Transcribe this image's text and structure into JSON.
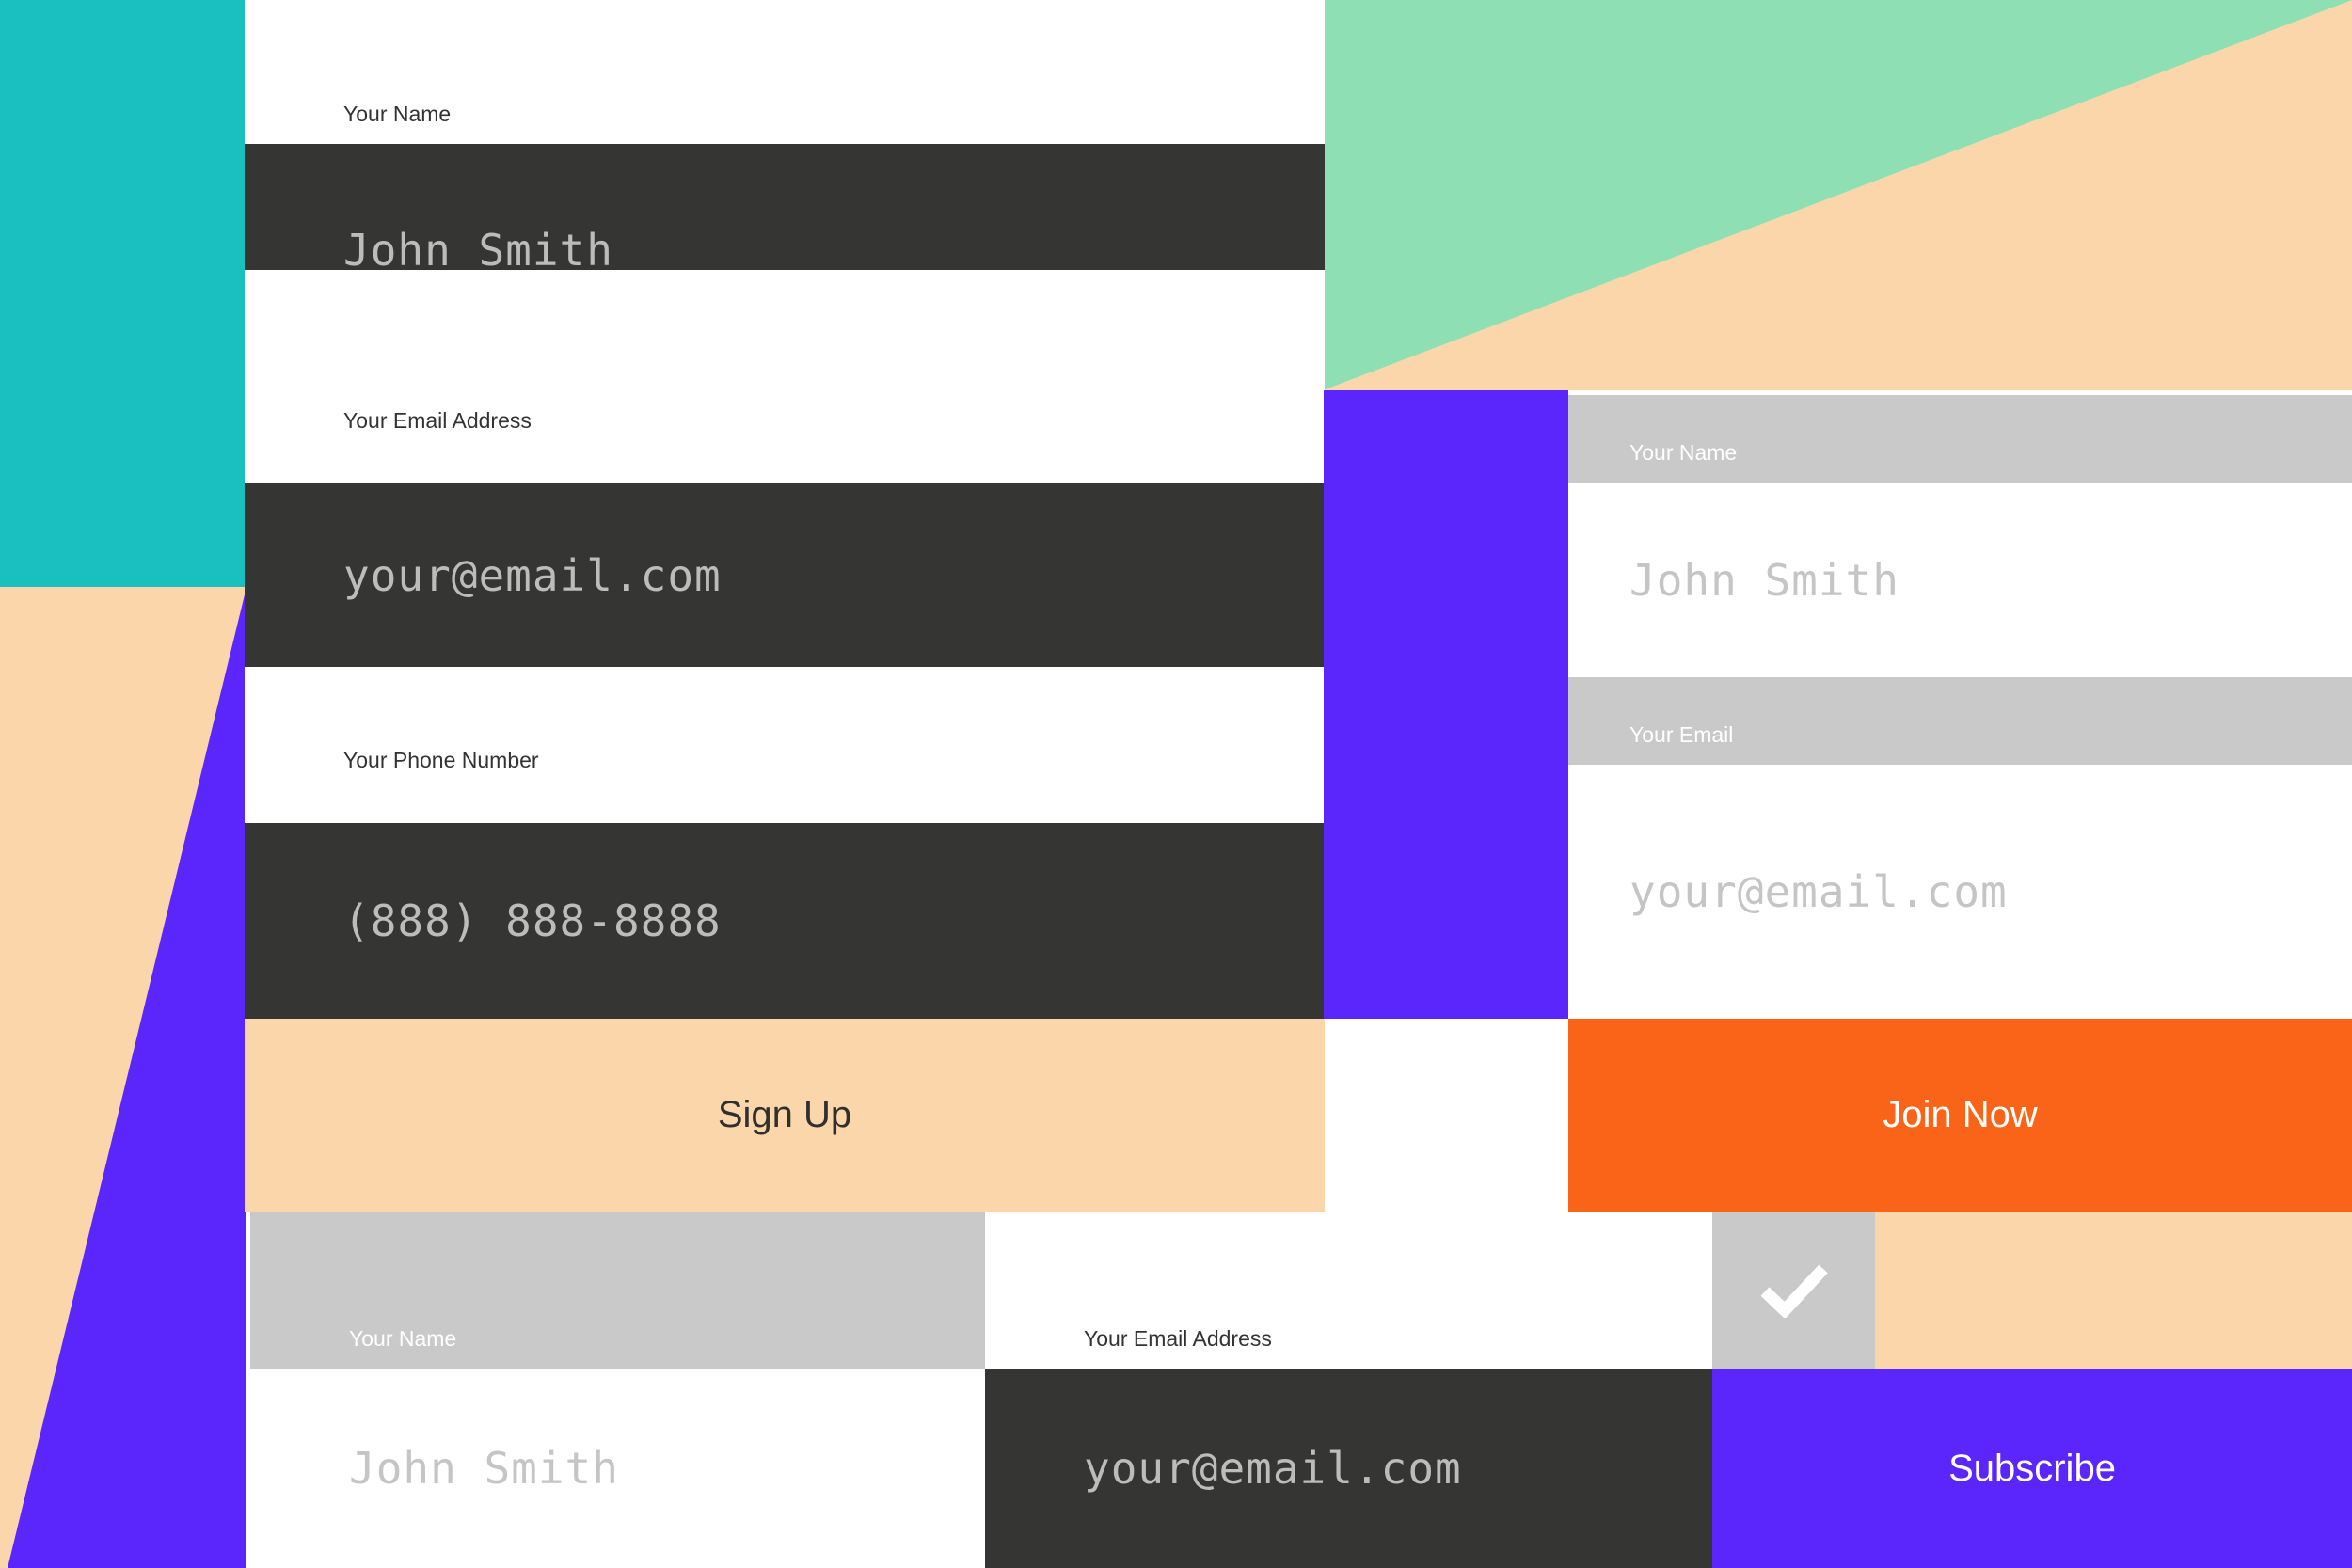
{
  "colors": {
    "teal": "#1abfbf",
    "peach": "#fcd6ab",
    "mint": "#8ee0b4",
    "purple": "#5a26fb",
    "orange": "#fa6418",
    "dark_field": "#353533",
    "gray_label": "#c9c9c9",
    "placeholder_on_dark": "#bcbcbc",
    "placeholder_on_white": "#c5c5c5",
    "label_dark_text": "#333333",
    "white": "#ffffff"
  },
  "form_signup": {
    "name_label": "Your Name",
    "name_value": "John Smith",
    "email_label": "Your Email Address",
    "email_value": "your@email.com",
    "phone_label": "Your Phone Number",
    "phone_value": "(888) 888-8888",
    "submit_label": "Sign Up"
  },
  "form_join": {
    "name_label": "Your Name",
    "name_value": "John Smith",
    "email_label": "Your Email",
    "email_value": "your@email.com",
    "submit_label": "Join Now"
  },
  "form_subscribe": {
    "name_label": "Your Name",
    "name_value": "John Smith",
    "email_label": "Your Email Address",
    "email_value": "your@email.com",
    "checkbox_icon": "checkmark-icon",
    "checkbox_checked": true,
    "submit_label": "Subscribe"
  }
}
